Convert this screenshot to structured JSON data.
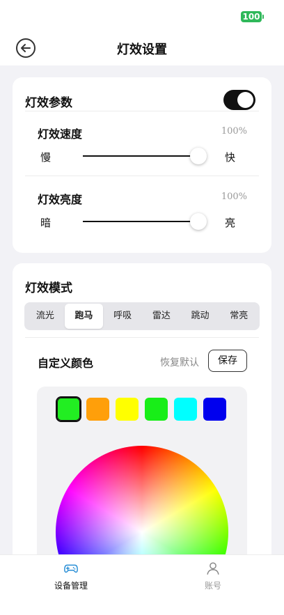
{
  "status_bar": {
    "battery": "100"
  },
  "header": {
    "title": "灯效设置"
  },
  "light_params": {
    "title": "灯效参数",
    "enabled": true,
    "speed": {
      "label": "灯效速度",
      "percent": "100%",
      "value": 100,
      "min_label": "慢",
      "max_label": "快"
    },
    "brightness": {
      "label": "灯效亮度",
      "percent": "100%",
      "value": 100,
      "min_label": "暗",
      "max_label": "亮"
    }
  },
  "light_mode": {
    "title": "灯效模式",
    "tabs": [
      {
        "label": "流光",
        "active": false
      },
      {
        "label": "跑马",
        "active": true
      },
      {
        "label": "呼吸",
        "active": false
      },
      {
        "label": "雷达",
        "active": false
      },
      {
        "label": "跳动",
        "active": false
      },
      {
        "label": "常亮",
        "active": false
      }
    ],
    "custom_color_label": "自定义颜色",
    "restore_default_label": "恢复默认",
    "save_label": "保存",
    "swatches": [
      "#22ee22",
      "#ff9f0a",
      "#ffff00",
      "#18ee18",
      "#00ffff",
      "#0000ee"
    ],
    "selected_swatch": 0
  },
  "bottom_nav": [
    {
      "label": "设备管理",
      "icon": "gamepad-icon",
      "active": true,
      "color": "#111111"
    },
    {
      "label": "账号",
      "icon": "user-icon",
      "active": false,
      "color": "#999999"
    }
  ]
}
